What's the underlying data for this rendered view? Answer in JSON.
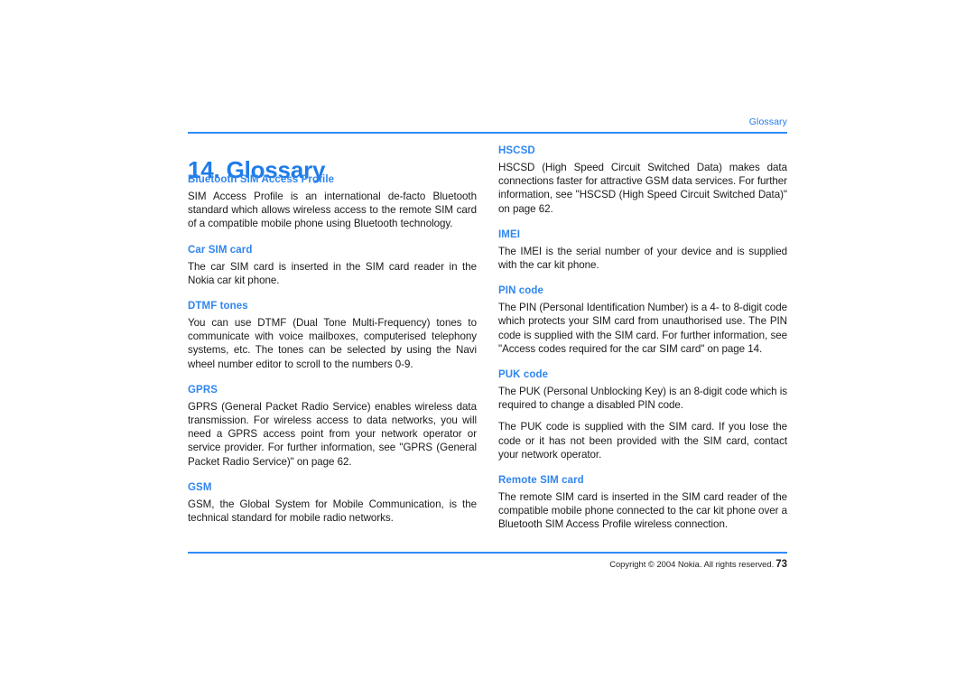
{
  "theme": {
    "accent_blue": "#2f8cf5",
    "heading_blue": "#1f7cea",
    "term_blue": "#2f86ef",
    "body_black": "#1a1a1a",
    "page_background": "#ffffff"
  },
  "header": {
    "running_head": "Glossary"
  },
  "chapter": {
    "title": "14. Glossary"
  },
  "left_column": {
    "entries": [
      {
        "term": "Bluetooth SIM Access Profile",
        "paragraphs": [
          "SIM Access Profile is an international de-facto Bluetooth standard which allows wireless access to the remote SIM card of a compatible mobile phone using Bluetooth technology."
        ]
      },
      {
        "term": "Car SIM card",
        "paragraphs": [
          "The car SIM card is inserted in the SIM card reader in the Nokia car kit phone."
        ]
      },
      {
        "term": "DTMF tones",
        "paragraphs": [
          "You can use DTMF (Dual Tone Multi-Frequency) tones to communicate with voice mailboxes, computerised telephony systems, etc. The tones can be selected by using the Navi wheel number editor to scroll to the numbers 0-9."
        ]
      },
      {
        "term": "GPRS",
        "paragraphs": [
          "GPRS (General Packet Radio Service) enables wireless data transmission. For wireless access to data networks, you will need a GPRS access point from your network operator or service provider. For further information, see \"GPRS (General Packet Radio Service)\" on page 62."
        ]
      },
      {
        "term": "GSM",
        "paragraphs": [
          "GSM, the Global System for Mobile Communication, is the technical standard for mobile radio networks."
        ]
      }
    ]
  },
  "right_column": {
    "entries": [
      {
        "term": "HSCSD",
        "paragraphs": [
          "HSCSD (High Speed Circuit Switched Data) makes data connections faster for attractive GSM data services. For further information, see \"HSCSD (High Speed Circuit Switched Data)\" on page 62."
        ]
      },
      {
        "term": "IMEI",
        "paragraphs": [
          "The IMEI is the serial number of your device and is supplied with the car kit phone."
        ]
      },
      {
        "term": "PIN code",
        "paragraphs": [
          "The PIN (Personal Identification Number) is a 4- to 8-digit code which protects your SIM card from unauthorised use. The PIN code is supplied with the SIM card. For further information, see \"Access codes required for the car SIM card\" on page 14."
        ]
      },
      {
        "term": "PUK code",
        "paragraphs": [
          "The PUK (Personal Unblocking Key) is an 8-digit code which is required to change a disabled PIN code.",
          "The PUK code is supplied with the SIM card. If you lose the code or it has not been provided with the SIM card, contact your network operator."
        ]
      },
      {
        "term": "Remote SIM card",
        "paragraphs": [
          "The remote SIM card is inserted in the SIM card reader of the compatible mobile phone connected to the car kit phone over a Bluetooth SIM Access Profile wireless connection."
        ]
      }
    ]
  },
  "footer": {
    "copyright": "Copyright © 2004 Nokia. All rights reserved.",
    "page_number": "73"
  }
}
